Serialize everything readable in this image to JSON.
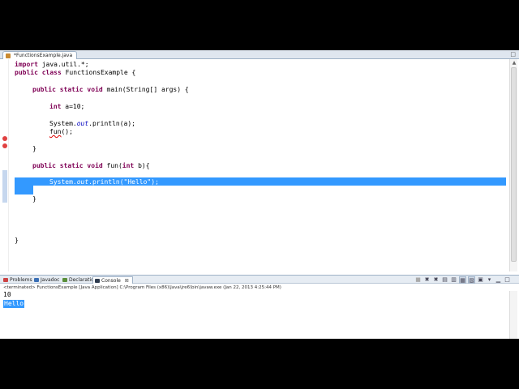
{
  "editor_tab": {
    "label": "*FunctionsExample.java",
    "close": "×"
  },
  "maximize_label": "□",
  "code_lines": {
    "l1": [
      "import",
      " java.util.*;"
    ],
    "l2": [
      "public class",
      " FunctionsExample {"
    ],
    "l4": [
      "public static void",
      " main(String[] args) {"
    ],
    "l6": [
      "int",
      " a=10;"
    ],
    "l8": [
      "System.",
      "out",
      ".println(a);"
    ],
    "l9": [
      "fun",
      "();"
    ],
    "l11": "}",
    "l13": [
      "public static void",
      " fun(",
      "int",
      " b)",
      "{"
    ],
    "l14": [
      "System.",
      "out",
      ".println(",
      "\"Hello\"",
      ");"
    ],
    "l16": "}",
    "l19": "}"
  },
  "console": {
    "tabs": [
      "Problems",
      "Javadoc",
      "Declaration",
      "Console"
    ],
    "console_close": "⊠",
    "status": "<terminated> FunctionsExample [Java Application] C:\\Program Files (x86)\\Java\\jre6\\bin\\javaw.exe (Jan 22, 2013 4:25:44 PM)",
    "output": [
      "10",
      "Hello"
    ]
  },
  "icons": {
    "tab_icon": "java-file-icon",
    "toolbar": [
      "terminate-icon",
      "remove-launch-icon",
      "remove-all-icon",
      "scroll-lock-icon",
      "word-wrap-icon",
      "pin-console-icon",
      "display-console-icon",
      "open-console-icon",
      "minimize-icon",
      "maximize-icon"
    ]
  },
  "colors": {
    "selection": "#3399ff",
    "keyword": "#7f0055",
    "field": "#0000c0",
    "string": "#2a00ff"
  }
}
